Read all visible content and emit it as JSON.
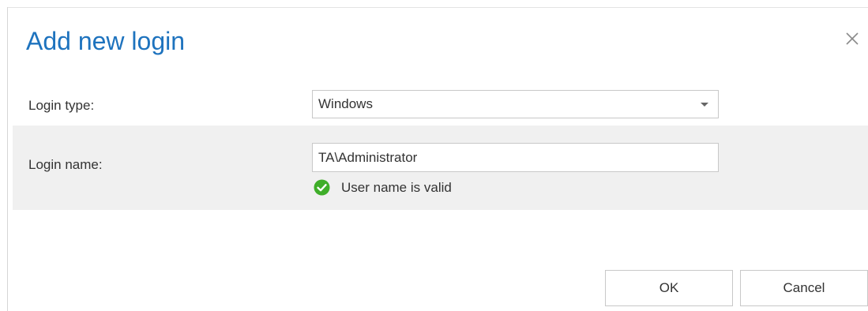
{
  "dialog": {
    "title": "Add new login",
    "close_icon": "close-icon"
  },
  "form": {
    "login_type": {
      "label": "Login type:",
      "selected": "Windows"
    },
    "login_name": {
      "label": "Login name:",
      "value": "TA\\Administrator",
      "validation_icon": "check-circle-icon",
      "validation_message": "User name is valid"
    }
  },
  "buttons": {
    "ok_label": "OK",
    "cancel_label": "Cancel"
  },
  "colors": {
    "title": "#1e73be",
    "alt_row_background": "#f0f0f0",
    "valid": "#3fae29"
  }
}
